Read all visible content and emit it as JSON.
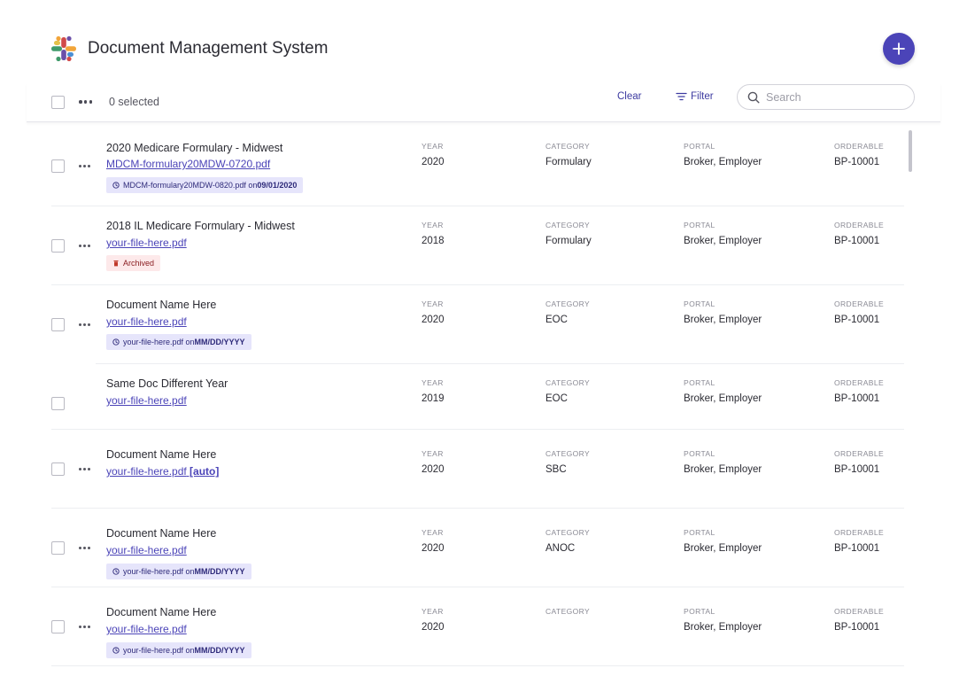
{
  "app": {
    "title": "Document Management System",
    "accent": "#4b44b8"
  },
  "toolbar": {
    "selected_label": "0 selected",
    "clear_label": "Clear",
    "filter_label": "Filter",
    "search_placeholder": "Search"
  },
  "columns": {
    "year": "YEAR",
    "category": "CATEGORY",
    "portal": "PORTAL",
    "orderable": "ORDERABLE"
  },
  "rows": [
    {
      "title": "2020 Medicare Formulary - Midwest",
      "file": "MDCM-formulary20MDW-0720.pdf",
      "file_suffix": "",
      "pill_type": "version",
      "pill_prefix": "MDCM-formulary20MDW-0820.pdf on ",
      "pill_bold": "09/01/2020",
      "year": "2020",
      "category": "Formulary",
      "portal": "Broker, Employer",
      "orderable": "BP-10001",
      "has_menu": true
    },
    {
      "title": "2018 IL Medicare Formulary - Midwest",
      "file": "your-file-here.pdf",
      "file_suffix": "",
      "pill_type": "archived",
      "pill_prefix": "Archived",
      "pill_bold": "",
      "year": "2018",
      "category": "Formulary",
      "portal": "Broker, Employer",
      "orderable": "BP-10001",
      "has_menu": true
    },
    {
      "title": "Document Name Here",
      "file": "your-file-here.pdf",
      "file_suffix": "",
      "pill_type": "version",
      "pill_prefix": "your-file-here.pdf on ",
      "pill_bold": "MM/DD/YYYY",
      "year": "2020",
      "category": "EOC",
      "portal": "Broker, Employer",
      "orderable": "BP-10001",
      "has_menu": true
    },
    {
      "title": "Same Doc Different Year",
      "file": "your-file-here.pdf",
      "file_suffix": "",
      "pill_type": "",
      "pill_prefix": "",
      "pill_bold": "",
      "year": "2019",
      "category": "EOC",
      "portal": "Broker, Employer",
      "orderable": "BP-10001",
      "has_menu": false
    },
    {
      "title": "Document Name Here",
      "file": "your-file-here.pdf",
      "file_suffix": "[auto]",
      "pill_type": "",
      "pill_prefix": "",
      "pill_bold": "",
      "year": "2020",
      "category": "SBC",
      "portal": "Broker, Employer",
      "orderable": "BP-10001",
      "has_menu": true
    },
    {
      "title": "Document Name Here",
      "file": "your-file-here.pdf",
      "file_suffix": "",
      "pill_type": "version",
      "pill_prefix": "your-file-here.pdf on ",
      "pill_bold": "MM/DD/YYYY",
      "year": "2020",
      "category": "ANOC",
      "portal": "Broker, Employer",
      "orderable": "BP-10001",
      "has_menu": true
    },
    {
      "title": "Document Name Here",
      "file": "your-file-here.pdf",
      "file_suffix": "",
      "pill_type": "version",
      "pill_prefix": "your-file-here.pdf on ",
      "pill_bold": "MM/DD/YYYY",
      "year": "2020",
      "category": "",
      "portal": "Broker, Employer",
      "orderable": "BP-10001",
      "has_menu": true
    }
  ],
  "icons": {
    "logo": "logo-icon",
    "add": "plus-icon",
    "filter": "filter-icon",
    "search": "search-icon",
    "version": "clock-icon",
    "archived": "trash-icon"
  }
}
